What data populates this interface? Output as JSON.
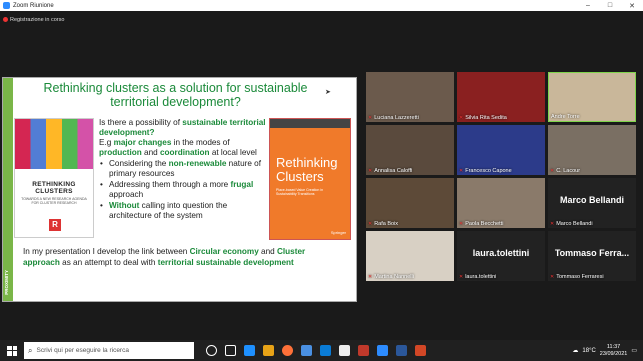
{
  "window": {
    "title": "Zoom Riunione",
    "controls": [
      "–",
      "□",
      "✕"
    ]
  },
  "recording": {
    "label": "Registrazione in corso"
  },
  "slide": {
    "title": "Rethinking clusters as a solution for sustainable territorial development?",
    "side_label": "PROXIMITY",
    "book1": {
      "title": "RETHINKING CLUSTERS",
      "subtitle": "TOWARDS A NEW RESEARCH AGENDA FOR CLUSTER RESEARCH",
      "logo": "R"
    },
    "book2": {
      "title": "Rethinking Clusters",
      "subtitle": "Place-based Value Creation in Sustainability Transitions",
      "publisher": "Springer"
    },
    "line1a": "Is there a possibility of ",
    "line1b": "sustainable territorial development?",
    "line2a": "E.g ",
    "line2b": "major changes",
    "line2c": " in the modes of ",
    "line2d": "production",
    "line2e": " and ",
    "line2f": "coordination",
    "line2g": " at local level",
    "b1a": "Considering the ",
    "b1b": "non-renewable",
    "b1c": " nature of primary resources",
    "b2a": "Addressing them through a more ",
    "b2b": "frugal",
    "b2c": " approach",
    "b3a": "Without",
    "b3b": " calling into question the architecture of the system",
    "f1": "In my presentation I develop the link between ",
    "f2": "Circular economy",
    "f3": "  and ",
    "f4": "Cluster approach",
    "f5": " as an attempt to deal with ",
    "f6": "territorial sustainable development"
  },
  "participants": [
    {
      "name": "Luciana Lazzeretti"
    },
    {
      "name": "Silvia Rita Sedita"
    },
    {
      "name": "Andre Torre"
    },
    {
      "name": "Annalisa Caloffi"
    },
    {
      "name": "Francesco Capone"
    },
    {
      "name": "C. Lacour"
    },
    {
      "name": "Rafa Boix"
    },
    {
      "name": "Paola Becchetti"
    },
    {
      "name": "Marco Bellandi",
      "big": "Marco Bellandi"
    },
    {
      "name": "Martina Nannelli"
    },
    {
      "name": "laura.tolettini",
      "big": "laura.tolettini"
    },
    {
      "name": "Tommaso Ferraresi",
      "big": "Tommaso  Ferra..."
    }
  ],
  "taskbar": {
    "search_placeholder": "Scrivi qui per eseguire la ricerca",
    "temp": "18°C",
    "time": "11:37",
    "date": "23/09/2021"
  }
}
